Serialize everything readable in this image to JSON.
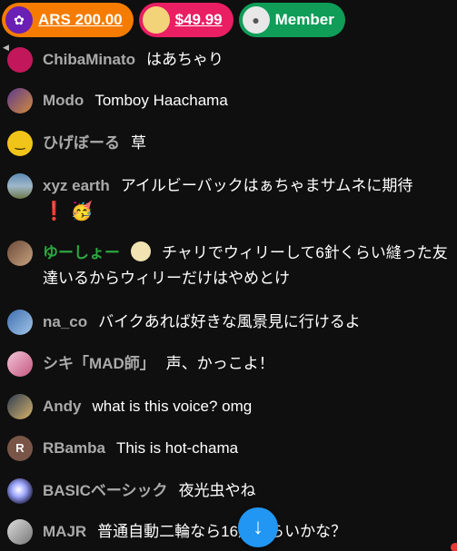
{
  "ticker": {
    "items": [
      {
        "amount": "ARS 200.00",
        "color": "#f57c00"
      },
      {
        "amount": "$49.99",
        "color": "#e91e63"
      },
      {
        "amount": "Member",
        "color": "#0f9d58"
      }
    ]
  },
  "messages": [
    {
      "author": "ChibaMinato",
      "text": "はあちゃり"
    },
    {
      "author": "Modo",
      "text": "Tomboy Haachama"
    },
    {
      "author": "ひげぼーる",
      "text": "草"
    },
    {
      "author": "xyz earth",
      "text": "アイルビーバックはぁちゃまサムネに期待"
    },
    {
      "author": "ゆーしょー",
      "text": "チャリでウィリーして6針くらい縫った友達いるからウィリーだけはやめとけ",
      "member": true
    },
    {
      "author": "na_co",
      "text": "バイクあれば好きな風景見に行けるよ"
    },
    {
      "author": "シキ「MAD師」",
      "text": "声、かっこよ！"
    },
    {
      "author": "Andy",
      "text": "what is this voice? omg"
    },
    {
      "author": "RBamba",
      "text": "This is hot-chama",
      "avatar_letter": "R"
    },
    {
      "author": "BASICベーシック",
      "text": "夜光虫やね"
    },
    {
      "author": "MAJR",
      "text": "普通自動二輪なら16歳くらいかな？"
    }
  ],
  "icons": {
    "scroll_down": "arrow-down-icon",
    "excl_emoji": "❗",
    "party_emoji": "🥳",
    "scroll_glyph": "↓"
  }
}
